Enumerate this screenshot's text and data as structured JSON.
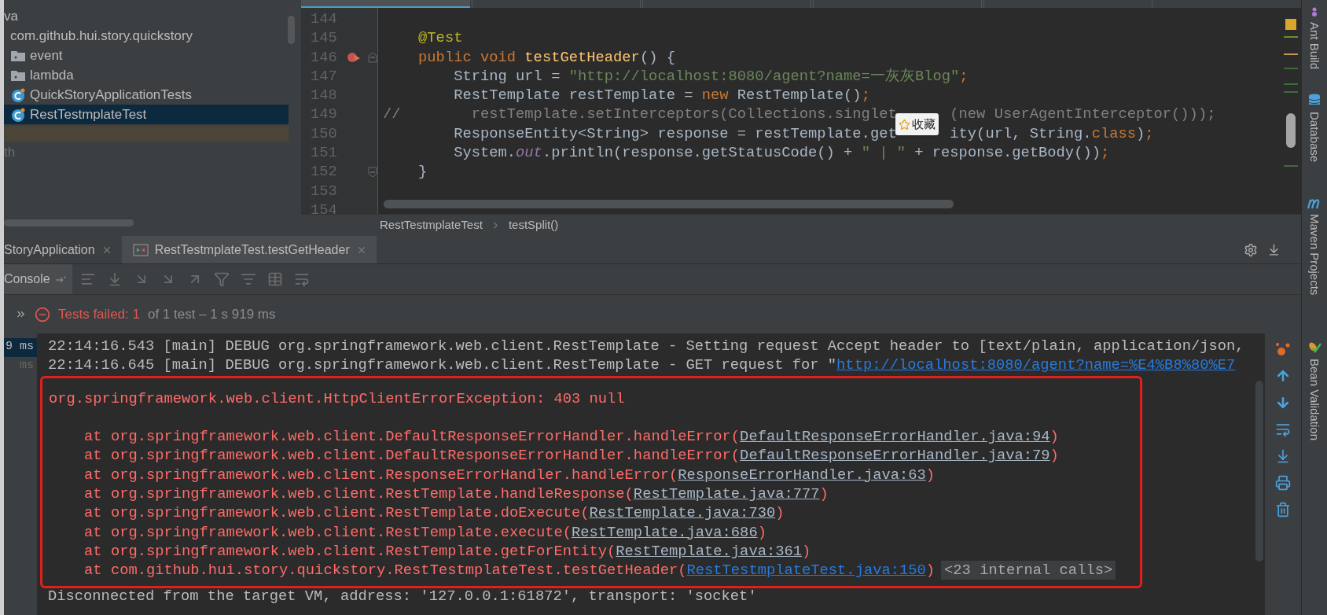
{
  "project_tree": {
    "items": [
      {
        "label": "va",
        "kind": "plain",
        "selected": false
      },
      {
        "label": "com.github.hui.story.quickstory",
        "kind": "package",
        "selected": false
      },
      {
        "label": "event",
        "kind": "folder",
        "selected": false
      },
      {
        "label": "lambda",
        "kind": "folder",
        "selected": false
      },
      {
        "label": "QuickStoryApplicationTests",
        "kind": "class",
        "selected": false
      },
      {
        "label": "RestTestmplateTest",
        "kind": "class",
        "selected": true
      }
    ],
    "footer": "th"
  },
  "editor": {
    "tabs": [
      {
        "selected": true
      },
      {
        "selected": false
      },
      {
        "selected": false
      },
      {
        "selected": false
      },
      {
        "selected": false
      }
    ],
    "lines": [
      {
        "number": "144",
        "run_marker": false
      },
      {
        "number": "145",
        "run_marker": false,
        "tokens": [
          {
            "kind": "annotation",
            "text": "    @Test"
          }
        ]
      },
      {
        "number": "146",
        "run_marker": true,
        "kind": "fold_start",
        "tokens": [
          {
            "kind": "keyword",
            "text": "    public void "
          },
          {
            "kind": "method",
            "text": "testGetHeader"
          },
          {
            "kind": "plain",
            "text": "() {"
          }
        ]
      },
      {
        "number": "147",
        "run_marker": false,
        "tokens": [
          {
            "kind": "plain",
            "text": "        String url = "
          },
          {
            "kind": "string",
            "text": "\"http://localhost:8080/agent?name=一灰灰Blog\""
          },
          {
            "kind": "keyword",
            "text": ";"
          }
        ]
      },
      {
        "number": "148",
        "run_marker": false,
        "tokens": [
          {
            "kind": "plain",
            "text": "        RestTemplate restTemplate = "
          },
          {
            "kind": "keyword",
            "text": "new "
          },
          {
            "kind": "plain",
            "text": "RestTemplate()"
          },
          {
            "kind": "keyword",
            "text": ";"
          }
        ]
      },
      {
        "number": "149",
        "run_marker": false,
        "overlay": {
          "label": "收藏"
        },
        "tokens": [
          {
            "kind": "comment",
            "text": "//        restTemplate.setInterceptors(Collections.singlet"
          },
          {
            "kind": "covered"
          },
          {
            "kind": "comment",
            "text": "(new UserAgentInterceptor()));"
          }
        ]
      },
      {
        "number": "150",
        "run_marker": false,
        "tokens": [
          {
            "kind": "plain",
            "text": "        ResponseEntity<String> response = restTemplate.get"
          },
          {
            "kind": "covered"
          },
          {
            "kind": "plain",
            "text": "ity(url, String."
          },
          {
            "kind": "keyword",
            "text": "class"
          },
          {
            "kind": "plain",
            "text": ")"
          },
          {
            "kind": "keyword",
            "text": ";"
          }
        ]
      },
      {
        "number": "151",
        "run_marker": false,
        "tokens": [
          {
            "kind": "plain",
            "text": "        System."
          },
          {
            "kind": "field",
            "text": "out"
          },
          {
            "kind": "plain",
            "text": ".println(response.getStatusCode() + "
          },
          {
            "kind": "string",
            "text": "\" | \""
          },
          {
            "kind": "plain",
            "text": " + response.getBody())"
          },
          {
            "kind": "keyword",
            "text": ";"
          }
        ]
      },
      {
        "number": "152",
        "run_marker": false,
        "kind": "fold_end",
        "tokens": [
          {
            "kind": "plain",
            "text": "    }"
          }
        ]
      },
      {
        "number": "153",
        "run_marker": false
      },
      {
        "number": "154",
        "run_marker": false
      }
    ],
    "breadcrumbs": [
      "RestTestmplateTest",
      "testSplit()"
    ]
  },
  "run_panel": {
    "tabs": [
      {
        "label": "StoryApplication",
        "selected": false
      },
      {
        "label": "RestTestmplateTest.testGetHeader",
        "selected": true
      }
    ],
    "console_tab": "Console",
    "status": {
      "failed": "Tests failed: 1",
      "detail": "of 1 test – 1 s 919 ms"
    },
    "test_times": [
      {
        "text": "9 ms",
        "selected": true
      },
      {
        "text": "ms",
        "selected": false
      }
    ],
    "log_lines": [
      {
        "text": "22:14:16.543 [main] DEBUG org.springframework.web.client.RestTemplate - Setting request Accept header to [text/plain, application/json,"
      },
      {
        "text": "22:14:16.645 [main] DEBUG org.springframework.web.client.RestTemplate - GET request for \"",
        "link": "http://localhost:8080/agent?name=%E4%B8%80%E7"
      }
    ],
    "exception": {
      "title": "org.springframework.web.client.HttpClientErrorException: 403 null",
      "frames": [
        {
          "text": "    at org.springframework.web.client.DefaultResponseErrorHandler.handleError(",
          "link": "DefaultResponseErrorHandler.java:94",
          "kind": "library",
          "close": ")"
        },
        {
          "text": "    at org.springframework.web.client.DefaultResponseErrorHandler.handleError(",
          "link": "DefaultResponseErrorHandler.java:79",
          "kind": "library",
          "close": ")"
        },
        {
          "text": "    at org.springframework.web.client.ResponseErrorHandler.handleError(",
          "link": "ResponseErrorHandler.java:63",
          "kind": "library",
          "close": ")"
        },
        {
          "text": "    at org.springframework.web.client.RestTemplate.handleResponse(",
          "link": "RestTemplate.java:777",
          "kind": "library",
          "close": ")"
        },
        {
          "text": "    at org.springframework.web.client.RestTemplate.doExecute(",
          "link": "RestTemplate.java:730",
          "kind": "library",
          "close": ")"
        },
        {
          "text": "    at org.springframework.web.client.RestTemplate.execute(",
          "link": "RestTemplate.java:686",
          "kind": "library",
          "close": ")"
        },
        {
          "text": "    at org.springframework.web.client.RestTemplate.getForEntity(",
          "link": "RestTemplate.java:361",
          "kind": "library",
          "close": ")"
        },
        {
          "text": "    at com.github.hui.story.quickstory.RestTestmplateTest.testGetHeader(",
          "link": "RestTestmplateTest.java:150",
          "kind": "test",
          "close": ")",
          "badge": "<23 internal calls>"
        }
      ]
    },
    "footer": "Disconnected from the target VM, address: '127.0.0.1:61872', transport: 'socket'"
  },
  "tool_windows": [
    {
      "label": "Ant Build",
      "kind": "ant"
    },
    {
      "label": "Database",
      "kind": "database"
    },
    {
      "label": "Maven Projects",
      "kind": "maven"
    },
    {
      "label": "Bean Validation",
      "kind": "bean"
    }
  ]
}
